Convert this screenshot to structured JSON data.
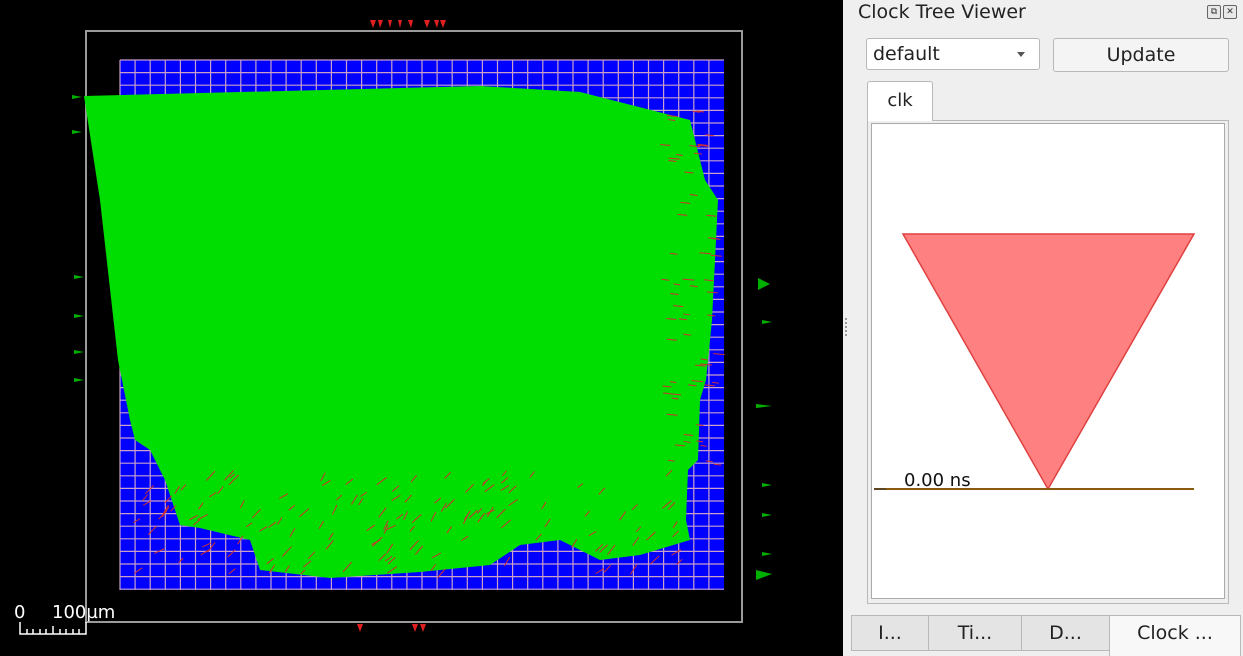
{
  "layout_view": {
    "scale_start": "0",
    "scale_label": "100µm",
    "colors": {
      "background": "#000000",
      "core": "#0000ff",
      "grid": "#c0a0c8",
      "routing": "#00dd00",
      "pins": "#e02020",
      "io": "#00c000"
    }
  },
  "panel": {
    "title": "Clock Tree Viewer",
    "controls": {
      "float": "⧉",
      "close": "✕"
    },
    "corner_select": {
      "value": "default"
    },
    "update_button": "Update",
    "clock_tab": "clk",
    "time_label": "0.00 ns",
    "colors": {
      "buffer_fill": "#ff8080",
      "buffer_stroke": "#e04040",
      "baseline": "#8a5a10"
    }
  },
  "bottom_tabs": [
    "I...",
    "Ti...",
    "D...",
    "Clock ..."
  ]
}
